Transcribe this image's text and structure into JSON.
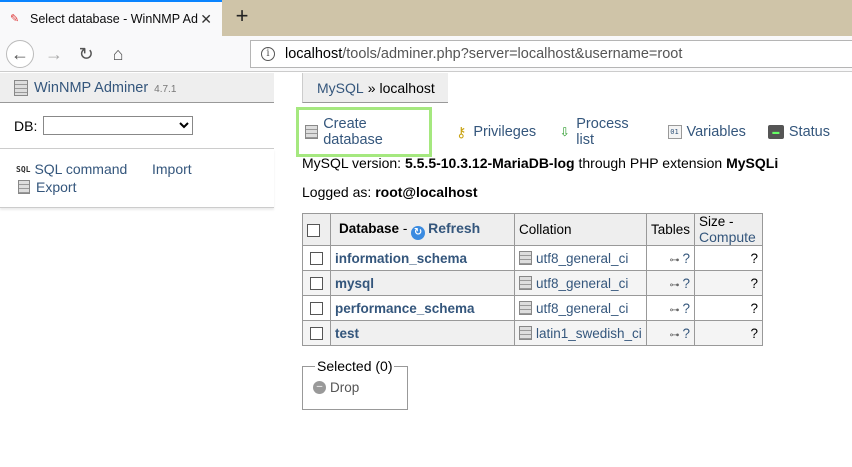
{
  "browser": {
    "tab_title": "Select database - WinNMP Admi",
    "tab_favicon": "pen-icon",
    "url_host": "localhost",
    "url_rest": "/tools/adminer.php?server=localhost&username=root"
  },
  "sidebar": {
    "app_name": "WinNMP Adminer",
    "version": "4.7.1",
    "db_label": "DB:",
    "db_selected": "",
    "sql_icon_text": "SQL",
    "sql_command": "SQL command",
    "import": "Import",
    "export": "Export"
  },
  "breadcrumb": {
    "first": "MySQL",
    "sep": "»",
    "current": "localhost"
  },
  "actions": {
    "create_database": "Create database",
    "privileges": "Privileges",
    "process_list": "Process list",
    "variables": "Variables",
    "status": "Status"
  },
  "info": {
    "version_prefix": "MySQL version:",
    "version": "5.5.5-10.3.12-MariaDB-log",
    "through": "through PHP extension",
    "extension": "MySQLi",
    "logged_prefix": "Logged as:",
    "user": "root@localhost"
  },
  "table": {
    "col_database": "Database",
    "col_dash": "-",
    "refresh": "Refresh",
    "col_collation": "Collation",
    "col_tables": "Tables",
    "col_size": "Size",
    "compute": "Compute",
    "rows": [
      {
        "name": "information_schema",
        "collation": "utf8_general_ci",
        "tables": "?",
        "size": "?"
      },
      {
        "name": "mysql",
        "collation": "utf8_general_ci",
        "tables": "?",
        "size": "?"
      },
      {
        "name": "performance_schema",
        "collation": "utf8_general_ci",
        "tables": "?",
        "size": "?"
      },
      {
        "name": "test",
        "collation": "latin1_swedish_ci",
        "tables": "?",
        "size": "?"
      }
    ]
  },
  "selected": {
    "legend": "Selected (0)",
    "drop": "Drop"
  }
}
